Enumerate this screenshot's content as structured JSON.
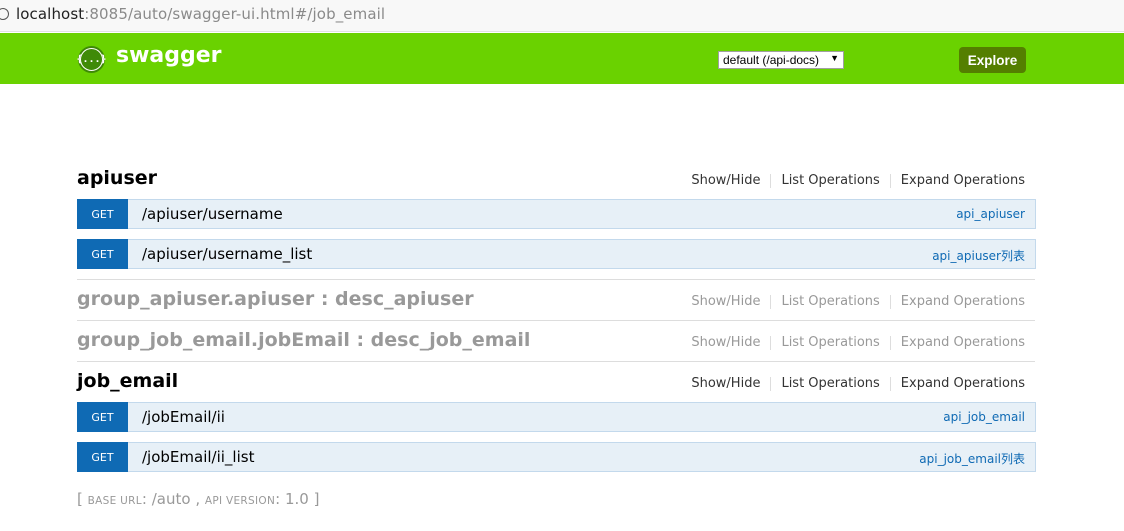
{
  "browser": {
    "url_host": "localhost",
    "url_rest": ":8085/auto/swagger-ui.html#/job_email"
  },
  "header": {
    "logo_glyph": "{...}",
    "logo_text": "swagger",
    "api_select_value": "default (/api-docs)",
    "explore_label": "Explore",
    "brand_color": "#6ad200"
  },
  "resources": [
    {
      "name": "apiuser",
      "muted": false,
      "links": [
        "Show/Hide",
        "List Operations",
        "Expand Operations"
      ],
      "operations": [
        {
          "method": "GET",
          "path": "/apiuser/username",
          "summary": "api_apiuser"
        },
        {
          "method": "GET",
          "path": "/apiuser/username_list",
          "summary": "api_apiuser列表"
        }
      ]
    },
    {
      "name": "group_apiuser.apiuser : desc_apiuser",
      "muted": true,
      "links": [
        "Show/Hide",
        "List Operations",
        "Expand Operations"
      ],
      "operations": []
    },
    {
      "name": "group_job_email.jobEmail : desc_job_email",
      "muted": true,
      "links": [
        "Show/Hide",
        "List Operations",
        "Expand Operations"
      ],
      "operations": []
    },
    {
      "name": "job_email",
      "muted": false,
      "links": [
        "Show/Hide",
        "List Operations",
        "Expand Operations"
      ],
      "operations": [
        {
          "method": "GET",
          "path": "/jobEmail/ii",
          "summary": "api_job_email"
        },
        {
          "method": "GET",
          "path": "/jobEmail/ii_list",
          "summary": "api_job_email列表"
        }
      ]
    }
  ],
  "footer": {
    "open": "[",
    "base_url_label": "base url",
    "base_url_value": "/auto",
    "api_version_label": "api version",
    "api_version_value": "1.0",
    "close": "]"
  }
}
